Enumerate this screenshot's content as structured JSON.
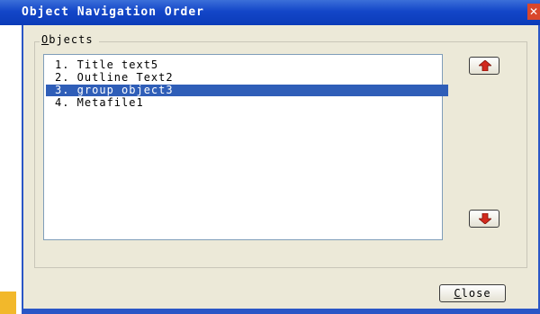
{
  "window": {
    "title": "Object Navigation Order",
    "close_glyph": "✕"
  },
  "group": {
    "label_accel": "O",
    "label_rest": "bjects"
  },
  "list": {
    "items": [
      {
        "label": "1. Title text5",
        "selected": false
      },
      {
        "label": "2. Outline Text2",
        "selected": false
      },
      {
        "label": "3. group object3",
        "selected": true
      },
      {
        "label": "4. Metafile1",
        "selected": false
      }
    ]
  },
  "buttons": {
    "move_up_icon": "arrow-up-icon",
    "move_down_icon": "arrow-down-icon",
    "close_accel": "C",
    "close_rest": "lose"
  },
  "colors": {
    "titlebar": "#1346c8",
    "selection": "#2f5eb8",
    "dialog_bg": "#ece9d8",
    "arrow": "#d22a1e"
  }
}
